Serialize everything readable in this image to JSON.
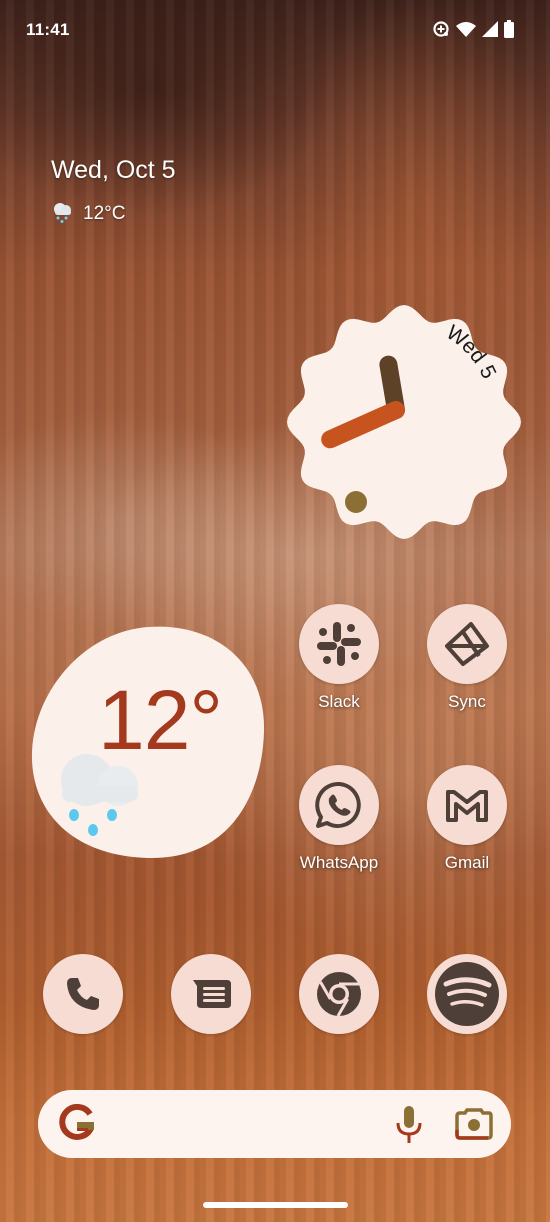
{
  "status_bar": {
    "time": "11:41",
    "icons": [
      "data-saver-icon",
      "wifi-icon",
      "cellular-signal-icon",
      "battery-icon"
    ]
  },
  "at_a_glance": {
    "date": "Wed, Oct 5",
    "weather_icon": "rain-cloud-icon",
    "temperature": "12°C"
  },
  "clock_widget": {
    "date_label": "Wed 5",
    "hour": 11,
    "minute": 41,
    "colors": {
      "face": "#fbf0ea",
      "hour_hand": "#5e4227",
      "minute_hand": "#c7541f",
      "dot": "#8c6f35"
    }
  },
  "weather_widget": {
    "temperature": "12°",
    "condition_icon": "rain-cloud-icon",
    "colors": {
      "text": "#a4391d",
      "background": "#fbf0ea"
    }
  },
  "apps": [
    {
      "label": "Slack",
      "icon": "slack-icon"
    },
    {
      "label": "Sync",
      "icon": "sync-icon"
    },
    {
      "label": "WhatsApp",
      "icon": "whatsapp-icon"
    },
    {
      "label": "Gmail",
      "icon": "gmail-icon"
    }
  ],
  "dock": [
    {
      "name": "Phone",
      "icon": "phone-icon"
    },
    {
      "name": "Messages",
      "icon": "messages-icon"
    },
    {
      "name": "Chrome",
      "icon": "chrome-icon"
    },
    {
      "name": "Spotify",
      "icon": "spotify-icon"
    }
  ],
  "search_bar": {
    "logo": "google-g-icon",
    "actions": [
      "microphone-icon",
      "lens-camera-icon"
    ]
  },
  "theme": {
    "icon_bg": "#f7dcd3",
    "icon_fg": "#4e3f38",
    "accent": "#a4391d"
  }
}
